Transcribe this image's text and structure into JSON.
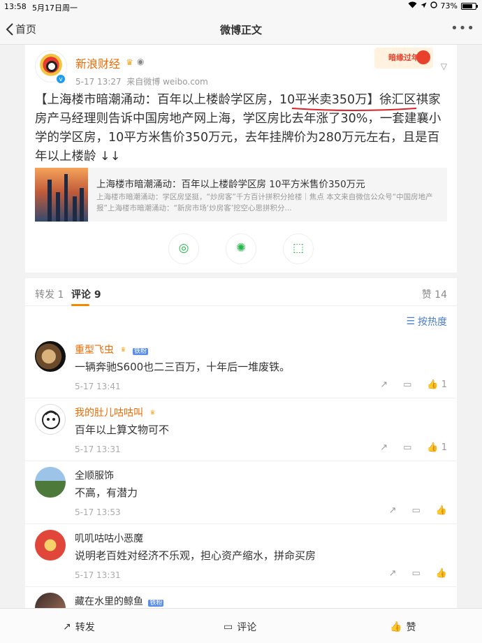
{
  "status_bar": {
    "time": "13:58",
    "date": "5月17日周一",
    "battery": "73%"
  },
  "nav": {
    "back_label": "首页",
    "title": "微博正文",
    "more": "•••"
  },
  "post": {
    "author": "新浪财经",
    "time": "5-17 13:27",
    "source": "来自微博 weibo.com",
    "festive_badge": "暗缘过年",
    "text": "【上海楼市暗潮涌动：百年以上楼龄学区房，10平米卖350万】徐汇区祺家房产马经理则告诉中国房地产网上海，学区房比去年涨了30%，一套建襄小学的学区房，10平方米售价350万元，去年挂牌价为280万元左右，且是百年以上楼龄 ↓↓",
    "link_card": {
      "title": "上海楼市暗潮涌动：百年以上楼龄学区房 10平方米售价350万元",
      "desc": "上海楼市暗潮涌动：学区房坚挺，“炒房客”千方百计拼积分抢楼｜焦点 本文来自微信公众号“中国房地产报”上海楼市暗潮涌动：“新房市场‘炒房客’挖空心思拼积分..."
    },
    "share_icons": [
      "wechat-icon",
      "moments-icon",
      "share-image-icon"
    ]
  },
  "tabs": {
    "repost": "转发 1",
    "comment": "评论 9",
    "like": "赞 14"
  },
  "comments": {
    "sort_label": "按热度",
    "items": [
      {
        "name": "重型飞虫",
        "name_color": "orange",
        "text": "一辆奔驰S600也二三百万，十年后一堆废铁。",
        "time": "5-17 13:41",
        "likes": "1"
      },
      {
        "name": "我的肚儿咕咕叫",
        "name_color": "orange",
        "text": "百年以上算文物可不",
        "time": "5-17 13:31",
        "likes": "1"
      },
      {
        "name": "全顺服饰",
        "name_color": "normal",
        "text": "不高，有潜力",
        "time": "5-17 13:53",
        "likes": ""
      },
      {
        "name": "叽叽咕咕小恶魔",
        "name_color": "normal",
        "text": "说明老百姓对经济不乐观，担心资产缩水，拼命买房",
        "time": "5-17 13:31",
        "likes": ""
      },
      {
        "name": "藏在水里的鲸鱼",
        "name_color": "normal",
        "text": "",
        "time": "",
        "likes": ""
      }
    ]
  },
  "bottom_bar": {
    "repost": "转发",
    "comment": "评论",
    "like": "赞"
  }
}
